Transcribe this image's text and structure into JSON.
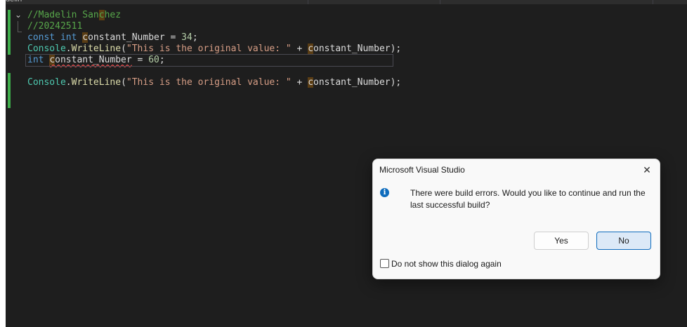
{
  "window": {
    "partial_label": "delin"
  },
  "editor": {
    "lines": [
      {
        "segments": [
          {
            "cls": "c",
            "text": "//Madelin San"
          },
          {
            "cls": "c hl",
            "text": "c"
          },
          {
            "cls": "c",
            "text": "hez"
          }
        ]
      },
      {
        "segments": [
          {
            "cls": "c",
            "text": "//20242511"
          }
        ]
      },
      {
        "segments": [
          {
            "cls": "k",
            "text": "const"
          },
          {
            "cls": "",
            "text": " "
          },
          {
            "cls": "k",
            "text": "int"
          },
          {
            "cls": "",
            "text": " "
          },
          {
            "cls": "hl",
            "text": "c"
          },
          {
            "cls": "",
            "text": "onstant_Number = "
          },
          {
            "cls": "n",
            "text": "34"
          },
          {
            "cls": "",
            "text": ";"
          }
        ]
      },
      {
        "segments": [
          {
            "cls": "t",
            "text": "Console"
          },
          {
            "cls": "",
            "text": "."
          },
          {
            "cls": "m",
            "text": "WriteLine"
          },
          {
            "cls": "",
            "text": "("
          },
          {
            "cls": "s",
            "text": "\"This is the original value: \""
          },
          {
            "cls": "",
            "text": " + "
          },
          {
            "cls": "hl",
            "text": "c"
          },
          {
            "cls": "",
            "text": "onstant_Number);"
          }
        ]
      },
      {
        "current": true,
        "segments": [
          {
            "cls": "k",
            "text": "int"
          },
          {
            "cls": "",
            "text": " "
          },
          {
            "cls": "squig hl",
            "text": "c"
          },
          {
            "cls": "squig",
            "text": "onstant_Number"
          },
          {
            "cls": "",
            "text": " = "
          },
          {
            "cls": "n",
            "text": "60"
          },
          {
            "cls": "",
            "text": ";"
          }
        ]
      },
      {
        "segments": []
      },
      {
        "segments": [
          {
            "cls": "t",
            "text": "Console"
          },
          {
            "cls": "",
            "text": "."
          },
          {
            "cls": "m",
            "text": "WriteLine"
          },
          {
            "cls": "",
            "text": "("
          },
          {
            "cls": "s",
            "text": "\"This is the original value: \""
          },
          {
            "cls": "",
            "text": " + "
          },
          {
            "cls": "hl",
            "text": "c"
          },
          {
            "cls": "",
            "text": "onstant_Number);"
          }
        ]
      }
    ]
  },
  "dialog": {
    "title": "Microsoft Visual Studio",
    "close_glyph": "✕",
    "icon": "info-icon",
    "message": "There were build errors. Would you like to continue and run the last successful build?",
    "yes_label": "Yes",
    "no_label": "No",
    "checkbox_label": "Do not show this dialog again",
    "checkbox_checked": false
  },
  "colors": {
    "editor_bg": "#1e1e1e",
    "change_bar": "#3fae4b",
    "accent": "#0f6cbd"
  }
}
